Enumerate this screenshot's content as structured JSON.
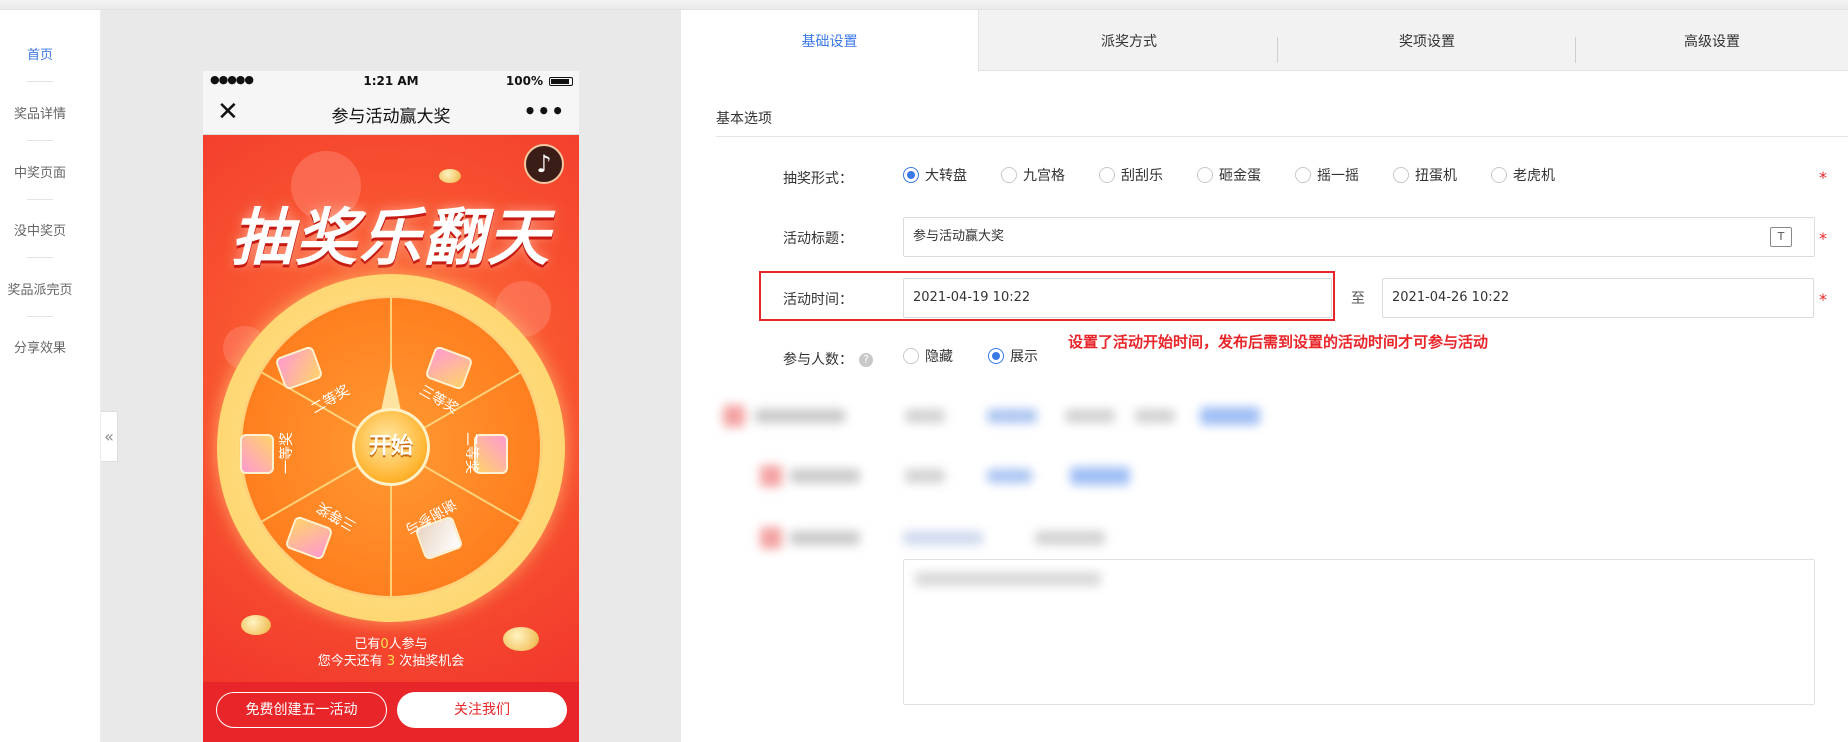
{
  "left_nav": {
    "items": [
      {
        "label": "首页",
        "active": true
      },
      {
        "label": "奖品详情",
        "active": false
      },
      {
        "label": "中奖页面",
        "active": false
      },
      {
        "label": "没中奖页",
        "active": false
      },
      {
        "label": "奖品派完页",
        "active": false
      },
      {
        "label": "分享效果",
        "active": false
      }
    ],
    "collapse_glyph": "«"
  },
  "phone": {
    "status": {
      "signal": "●●●●●",
      "time": "1:21 AM",
      "battery": "100%"
    },
    "navbar": {
      "close_glyph": "✕",
      "title": "参与活动赢大奖",
      "more_glyph": "•••"
    },
    "music_glyph": "♪",
    "headline": "抽奖乐翻天",
    "wheel": {
      "start_label": "开始",
      "prizes": [
        "二等奖",
        "三等奖",
        "二等奖",
        "谢谢参与",
        "三等奖",
        "一等奖"
      ]
    },
    "join_info": {
      "line1_prefix": "已有",
      "count": "0",
      "line1_suffix": "人参与",
      "line2_prefix": "您今天还有",
      "chances": "3",
      "line2_suffix": "次抽奖机会"
    },
    "buttons": {
      "create": "免费创建五一活动",
      "follow": "关注我们"
    }
  },
  "tabs": [
    {
      "label": "基础设置",
      "active": true
    },
    {
      "label": "派奖方式",
      "active": false
    },
    {
      "label": "奖项设置",
      "active": false
    },
    {
      "label": "高级设置",
      "active": false
    }
  ],
  "form": {
    "section_title": "基本选项",
    "lottery_type": {
      "label": "抽奖形式：",
      "options": [
        "大转盘",
        "九宫格",
        "刮刮乐",
        "砸金蛋",
        "摇一摇",
        "扭蛋机",
        "老虎机"
      ],
      "selected": "大转盘"
    },
    "title": {
      "label": "活动标题：",
      "value": "参与活动赢大奖",
      "icon": "T"
    },
    "time": {
      "label": "活动时间：",
      "start": "2021-04-19 10:22",
      "to": "至",
      "end": "2021-04-26 10:22"
    },
    "participants": {
      "label": "参与人数：",
      "help": "?",
      "options": [
        "隐藏",
        "展示"
      ],
      "selected": "展示"
    },
    "required_mark": "*"
  },
  "annotation": "设置了活动开始时间，发布后需到设置的活动时间才可参与活动",
  "colors": {
    "accent": "#3b78e7",
    "alert": "#e8262a"
  }
}
